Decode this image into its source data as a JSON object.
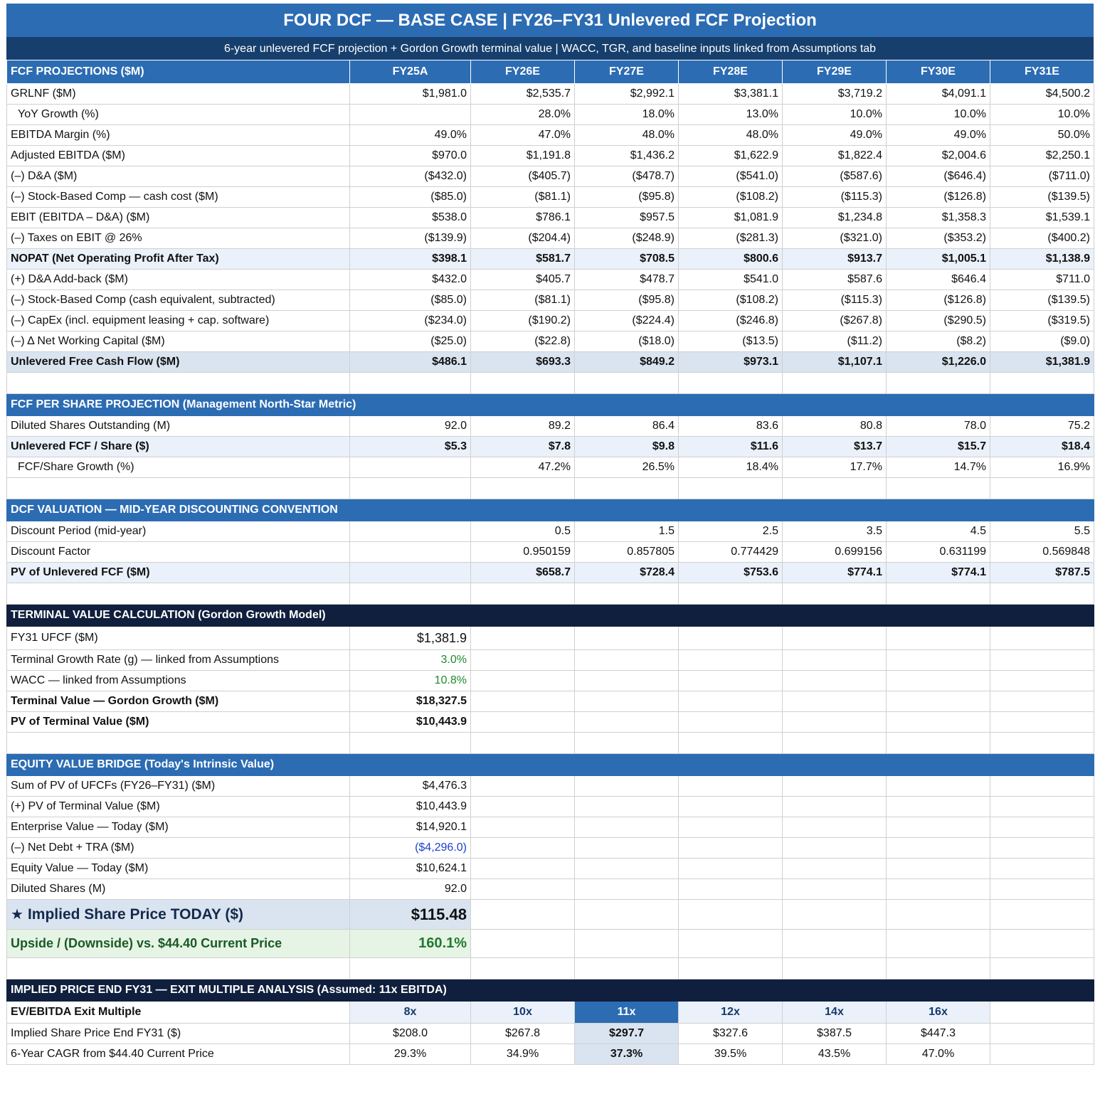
{
  "title": "FOUR DCF — BASE CASE  |  FY26–FY31 Unlevered FCF Projection",
  "subtitle": "6-year unlevered FCF projection + Gordon Growth terminal value  |  WACC, TGR, and baseline inputs linked from Assumptions tab",
  "fcf": {
    "header": "FCF PROJECTIONS ($M)",
    "years": [
      "FY25A",
      "FY26E",
      "FY27E",
      "FY28E",
      "FY29E",
      "FY30E",
      "FY31E"
    ],
    "rows": [
      {
        "label": "GRLNF ($M)",
        "style": "",
        "values": [
          "$1,981.0",
          "$2,535.7",
          "$2,992.1",
          "$3,381.1",
          "$3,719.2",
          "$4,091.1",
          "$4,500.2"
        ]
      },
      {
        "label": "YoY Growth (%)",
        "style": "indent",
        "values": [
          "",
          "28.0%",
          "18.0%",
          "13.0%",
          "10.0%",
          "10.0%",
          "10.0%"
        ]
      },
      {
        "label": "EBITDA Margin (%)",
        "style": "",
        "values": [
          "49.0%",
          "47.0%",
          "48.0%",
          "48.0%",
          "49.0%",
          "49.0%",
          "50.0%"
        ]
      },
      {
        "label": "Adjusted EBITDA ($M)",
        "style": "",
        "values": [
          "$970.0",
          "$1,191.8",
          "$1,436.2",
          "$1,622.9",
          "$1,822.4",
          "$2,004.6",
          "$2,250.1"
        ]
      },
      {
        "label": "(–) D&A ($M)",
        "style": "",
        "values": [
          "($432.0)",
          "($405.7)",
          "($478.7)",
          "($541.0)",
          "($587.6)",
          "($646.4)",
          "($711.0)"
        ]
      },
      {
        "label": "(–) Stock-Based Comp — cash cost ($M)",
        "style": "",
        "values": [
          "($85.0)",
          "($81.1)",
          "($95.8)",
          "($108.2)",
          "($115.3)",
          "($126.8)",
          "($139.5)"
        ]
      },
      {
        "label": "EBIT (EBITDA – D&A) ($M)",
        "style": "",
        "values": [
          "$538.0",
          "$786.1",
          "$957.5",
          "$1,081.9",
          "$1,234.8",
          "$1,358.3",
          "$1,539.1"
        ]
      },
      {
        "label": "(–) Taxes on EBIT @ 26%",
        "style": "",
        "values": [
          "($139.9)",
          "($204.4)",
          "($248.9)",
          "($281.3)",
          "($321.0)",
          "($353.2)",
          "($400.2)"
        ]
      },
      {
        "label": "NOPAT (Net Operating Profit After Tax)",
        "style": "bold shaded",
        "values": [
          "$398.1",
          "$581.7",
          "$708.5",
          "$800.6",
          "$913.7",
          "$1,005.1",
          "$1,138.9"
        ]
      },
      {
        "label": "(+) D&A Add-back ($M)",
        "style": "",
        "values": [
          "$432.0",
          "$405.7",
          "$478.7",
          "$541.0",
          "$587.6",
          "$646.4",
          "$711.0"
        ]
      },
      {
        "label": "(–) Stock-Based Comp (cash equivalent, subtracted)",
        "style": "",
        "values": [
          "($85.0)",
          "($81.1)",
          "($95.8)",
          "($108.2)",
          "($115.3)",
          "($126.8)",
          "($139.5)"
        ]
      },
      {
        "label": "(–) CapEx (incl. equipment leasing + cap. software)",
        "style": "",
        "values": [
          "($234.0)",
          "($190.2)",
          "($224.4)",
          "($246.8)",
          "($267.8)",
          "($290.5)",
          "($319.5)"
        ]
      },
      {
        "label": "(–) Δ Net Working Capital ($M)",
        "style": "",
        "values": [
          "($25.0)",
          "($22.8)",
          "($18.0)",
          "($13.5)",
          "($11.2)",
          "($8.2)",
          "($9.0)"
        ]
      },
      {
        "label": "Unlevered Free Cash Flow ($M)",
        "style": "ufcf",
        "values": [
          "$486.1",
          "$693.3",
          "$849.2",
          "$973.1",
          "$1,107.1",
          "$1,226.0",
          "$1,381.9"
        ]
      }
    ]
  },
  "per_share": {
    "header": "FCF PER SHARE PROJECTION  (Management North-Star Metric)",
    "rows": [
      {
        "label": "Diluted Shares Outstanding (M)",
        "style": "",
        "values": [
          "92.0",
          "89.2",
          "86.4",
          "83.6",
          "80.8",
          "78.0",
          "75.2"
        ]
      },
      {
        "label": "Unlevered FCF / Share ($)",
        "style": "bold shaded",
        "values": [
          "$5.3",
          "$7.8",
          "$9.8",
          "$11.6",
          "$13.7",
          "$15.7",
          "$18.4"
        ]
      },
      {
        "label": "FCF/Share Growth (%)",
        "style": "indent",
        "values": [
          "",
          "47.2%",
          "26.5%",
          "18.4%",
          "17.7%",
          "14.7%",
          "16.9%"
        ]
      }
    ]
  },
  "dcf": {
    "header": "DCF VALUATION — MID-YEAR DISCOUNTING CONVENTION",
    "rows": [
      {
        "label": "Discount Period (mid-year)",
        "style": "",
        "values": [
          "",
          "0.5",
          "1.5",
          "2.5",
          "3.5",
          "4.5",
          "5.5"
        ]
      },
      {
        "label": "Discount Factor",
        "style": "",
        "values": [
          "",
          "0.950159",
          "0.857805",
          "0.774429",
          "0.699156",
          "0.631199",
          "0.569848"
        ]
      },
      {
        "label": "PV of Unlevered FCF ($M)",
        "style": "bold shaded",
        "values": [
          "",
          "$658.7",
          "$728.4",
          "$753.6",
          "$774.1",
          "$774.1",
          "$787.5"
        ]
      }
    ]
  },
  "terminal": {
    "header": "TERMINAL VALUE CALCULATION  (Gordon Growth Model)",
    "rows": [
      {
        "label": "FY31 UFCF ($M)",
        "value": "$1,381.9",
        "style": "tall",
        "valclass": "big"
      },
      {
        "label": "Terminal Growth Rate (g) — linked from Assumptions",
        "value": "3.0%",
        "style": "",
        "valclass": "green"
      },
      {
        "label": "WACC — linked from Assumptions",
        "value": "10.8%",
        "style": "",
        "valclass": "green"
      },
      {
        "label": "Terminal Value — Gordon Growth ($M)",
        "value": "$18,327.5",
        "style": "bold",
        "valclass": ""
      },
      {
        "label": "PV of Terminal Value ($M)",
        "value": "$10,443.9",
        "style": "bold",
        "valclass": ""
      }
    ]
  },
  "bridge": {
    "header": "EQUITY VALUE BRIDGE  (Today's Intrinsic Value)",
    "rows": [
      {
        "label": "Sum of PV of UFCFs (FY26–FY31) ($M)",
        "value": "$4,476.3",
        "valclass": ""
      },
      {
        "label": "(+) PV of Terminal Value ($M)",
        "value": "$10,443.9",
        "valclass": ""
      },
      {
        "label": "Enterprise Value — Today ($M)",
        "value": "$14,920.1",
        "valclass": ""
      },
      {
        "label": "(–) Net Debt + TRA ($M)",
        "value": "($4,296.0)",
        "valclass": "blue"
      },
      {
        "label": "Equity Value — Today ($M)",
        "value": "$10,624.1",
        "valclass": ""
      },
      {
        "label": "Diluted Shares (M)",
        "value": "92.0",
        "valclass": ""
      }
    ],
    "price_label": "Implied Share Price TODAY ($)",
    "price_value": "$115.48",
    "upside_label": "Upside / (Downside) vs. $44.40 Current Price",
    "upside_value": "160.1%"
  },
  "exit": {
    "header": "IMPLIED PRICE END FY31 — EXIT MULTIPLE ANALYSIS  (Assumed: 11x EBITDA)",
    "multiple_label": "EV/EBITDA Exit Multiple",
    "multiples": [
      "8x",
      "10x",
      "11x",
      "12x",
      "14x",
      "16x"
    ],
    "selected_index": 2,
    "price_label": "Implied Share Price End FY31 ($)",
    "prices": [
      "$208.0",
      "$267.8",
      "$297.7",
      "$327.6",
      "$387.5",
      "$447.3"
    ],
    "cagr_label": "6-Year CAGR from $44.40 Current Price",
    "cagrs": [
      "29.3%",
      "34.9%",
      "37.3%",
      "39.5%",
      "43.5%",
      "47.0%"
    ]
  },
  "colors": {
    "header_blue": "#2c6cb3",
    "dark_navy": "#0f1f3d",
    "link_green": "#1f8a2e",
    "input_blue": "#1b3fd1"
  }
}
